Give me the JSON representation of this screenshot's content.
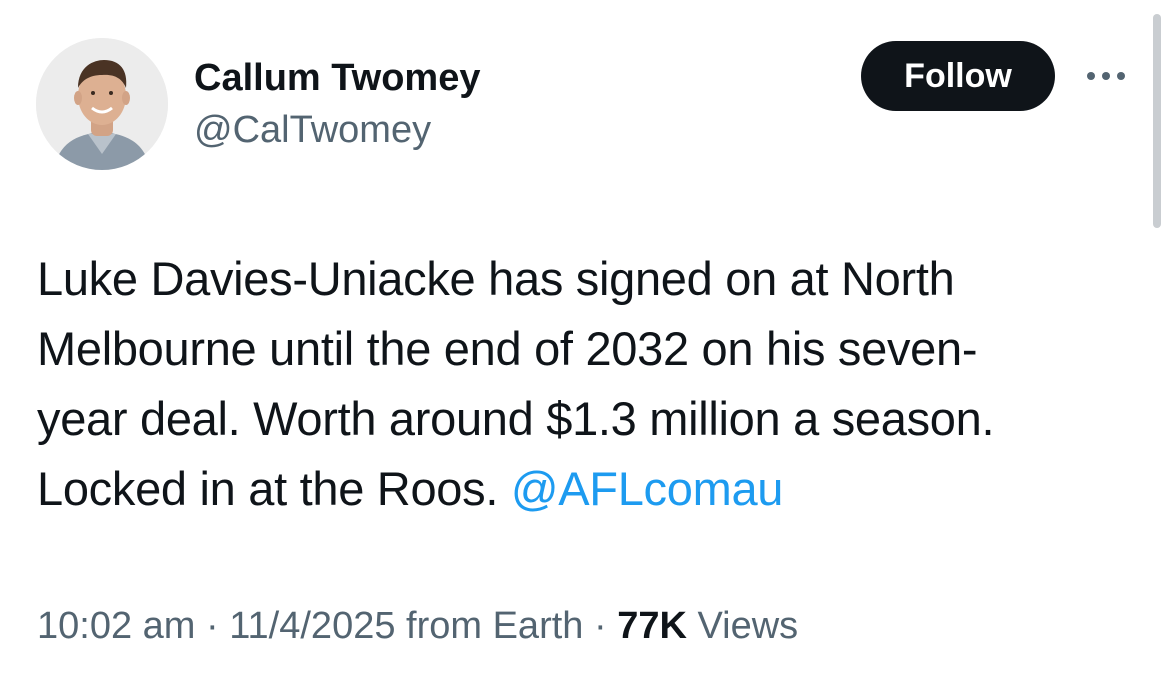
{
  "author": {
    "display_name": "Callum Twomey",
    "handle": "@CalTwomey"
  },
  "follow_button": {
    "label": "Follow"
  },
  "more_menu": {
    "icon": "more-horizontal-icon"
  },
  "tweet": {
    "lines": [
      "Luke Davies-Uniacke has signed on at North",
      "Melbourne until the end of 2032 on his seven-",
      "year deal. Worth around $1.3 million a season.",
      "Locked in at the Roos. "
    ],
    "mention": "@AFLcomau"
  },
  "meta": {
    "time": "10:02 am",
    "separator": " · ",
    "date": "11/4/2025",
    "source": " from Earth",
    "views_count": "77K",
    "views_label": " Views"
  },
  "colors": {
    "text": "#0f1419",
    "secondary": "#536471",
    "link": "#1d9bf0",
    "button_bg": "#0f1419"
  }
}
